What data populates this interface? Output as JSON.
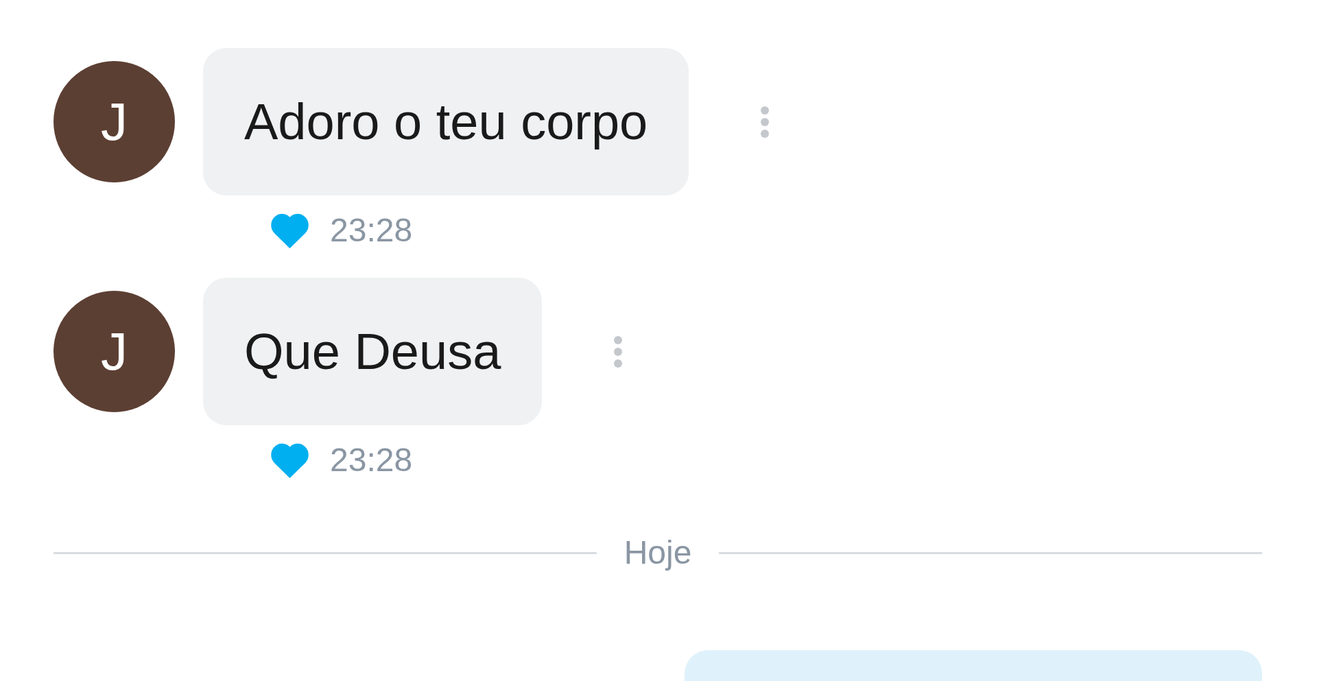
{
  "messages": [
    {
      "kind": "incoming",
      "avatar": "J",
      "text": "Adoro o teu corpo",
      "liked": true,
      "time": "23:28"
    },
    {
      "kind": "incoming",
      "avatar": "J",
      "text": "Que Deusa",
      "liked": true,
      "time": "23:28"
    }
  ],
  "day_divider": "Hoje",
  "outgoing": [
    {
      "kind": "outgoing"
    }
  ]
}
